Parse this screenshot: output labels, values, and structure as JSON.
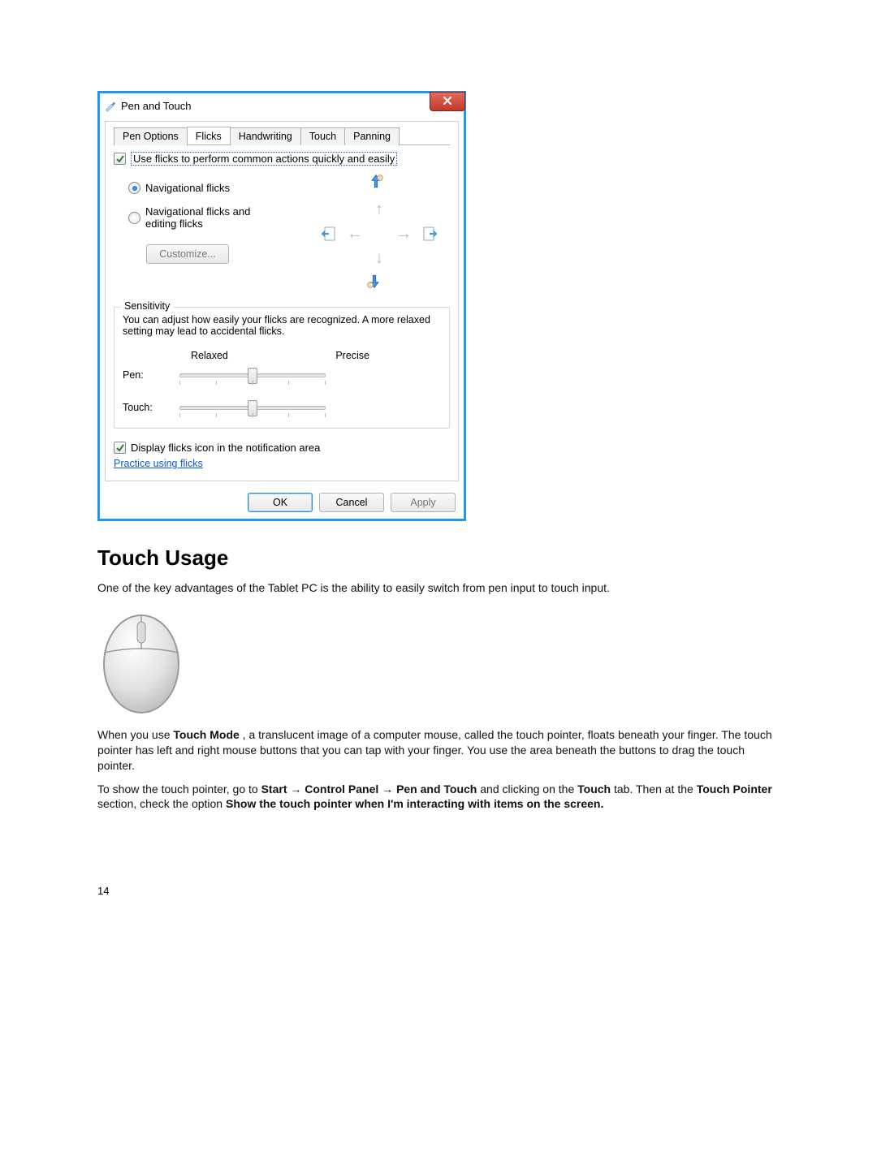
{
  "dialog": {
    "title": "Pen and Touch",
    "tabs": [
      "Pen Options",
      "Flicks",
      "Handwriting",
      "Touch",
      "Panning"
    ],
    "active_tab_index": 1,
    "use_flicks_checkbox": {
      "checked": true,
      "label": "Use flicks to perform common actions quickly and easily"
    },
    "radio": {
      "nav": "Navigational flicks",
      "nav_edit_1": "Navigational flicks and",
      "nav_edit_2": "editing flicks",
      "selected": "nav"
    },
    "customize_btn": "Customize...",
    "sensitivity": {
      "title": "Sensitivity",
      "desc": "You can adjust how easily your flicks are recognized. A more relaxed setting may lead to accidental flicks.",
      "label_left": "Relaxed",
      "label_right": "Precise",
      "pen_label": "Pen:",
      "touch_label": "Touch:"
    },
    "display_icon_checkbox": {
      "checked": true,
      "label": "Display flicks icon in the notification area"
    },
    "practice_link": "Practice using flicks",
    "buttons": {
      "ok": "OK",
      "cancel": "Cancel",
      "apply": "Apply"
    }
  },
  "article": {
    "heading": "Touch Usage",
    "p1": "One of the key advantages of the Tablet PC is the ability to easily switch from pen input to touch input.",
    "p2_a": "When you use ",
    "p2_bold1": "Touch Mode",
    "p2_b": " , a translucent image of a computer mouse, called the touch pointer, floats beneath your finger. The touch pointer has left and right mouse buttons that you can tap with your finger. You use the area beneath the buttons to drag the touch pointer.",
    "p3_a": "To show the touch pointer, go to ",
    "p3_b1": "Start",
    "p3_ar": " → ",
    "p3_b2": "Control Panel",
    "p3_b3": "Pen and Touch",
    "p3_mid": " and clicking on the ",
    "p3_b4": "Touch",
    "p3_end": " tab. Then at the ",
    "p4_b1": "Touch Pointer",
    "p4_mid": " section, check the option ",
    "p4_b2": "Show the touch pointer when I'm interacting with items on the screen."
  },
  "page_number": "14"
}
